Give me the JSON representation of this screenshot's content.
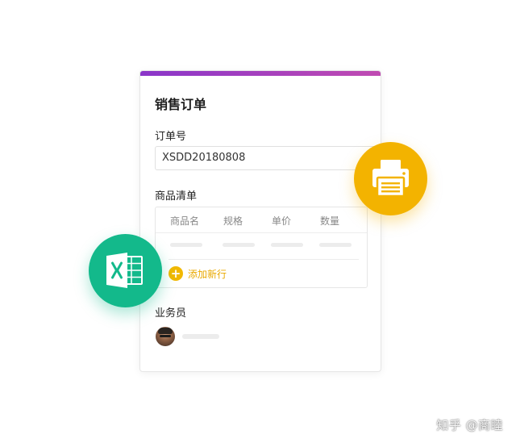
{
  "form": {
    "title": "销售订单",
    "order_no_label": "订单号",
    "order_no_value": "XSDD20180808",
    "items_label": "商品清单",
    "columns": [
      "商品名",
      "规格",
      "单价",
      "数量"
    ],
    "add_row_label": "添加新行",
    "add_row_icon": "plus-icon",
    "salesperson_label": "业务员"
  },
  "badges": {
    "print": {
      "icon": "printer-icon",
      "color": "#f3b300"
    },
    "excel": {
      "icon": "excel-icon",
      "color": "#13b98b"
    }
  },
  "accent": {
    "gradient_start": "#8a36c9",
    "gradient_end": "#c04bb2",
    "add_color": "#f1b800"
  },
  "watermark": "知乎 @商睦"
}
